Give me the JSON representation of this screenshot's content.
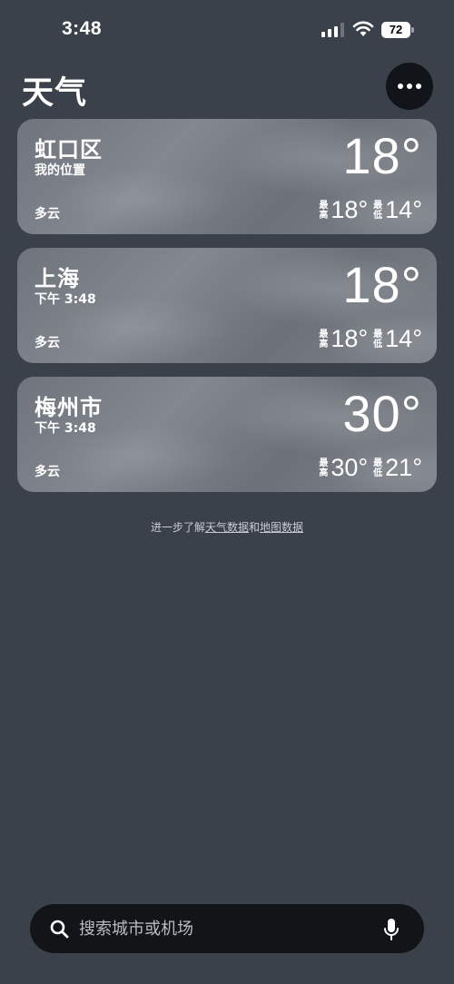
{
  "status_bar": {
    "time": "3:48",
    "battery": "72"
  },
  "header": {
    "title": "天气"
  },
  "cities": [
    {
      "name": "虹口区",
      "subtitle": "我的位置",
      "temp": "18°",
      "condition": "多云",
      "high_label": "最高",
      "high": "18°",
      "low_label": "最低",
      "low": "14°"
    },
    {
      "name": "上海",
      "subtitle": "下午 3:48",
      "temp": "18°",
      "condition": "多云",
      "high_label": "最高",
      "high": "18°",
      "low_label": "最低",
      "low": "14°"
    },
    {
      "name": "梅州市",
      "subtitle": "下午 3:48",
      "temp": "30°",
      "condition": "多云",
      "high_label": "最高",
      "high": "30°",
      "low_label": "最低",
      "low": "21°"
    }
  ],
  "footnote": {
    "prefix": "进一步了解",
    "weather_link": "天气数据",
    "joiner": "和",
    "map_link": "地图数据"
  },
  "search": {
    "placeholder": "搜索城市或机场"
  },
  "icons": {
    "search": "search-icon",
    "mic": "mic-icon",
    "more": "ellipsis-icon",
    "wifi": "wifi-icon",
    "signal": "signal-icon"
  }
}
